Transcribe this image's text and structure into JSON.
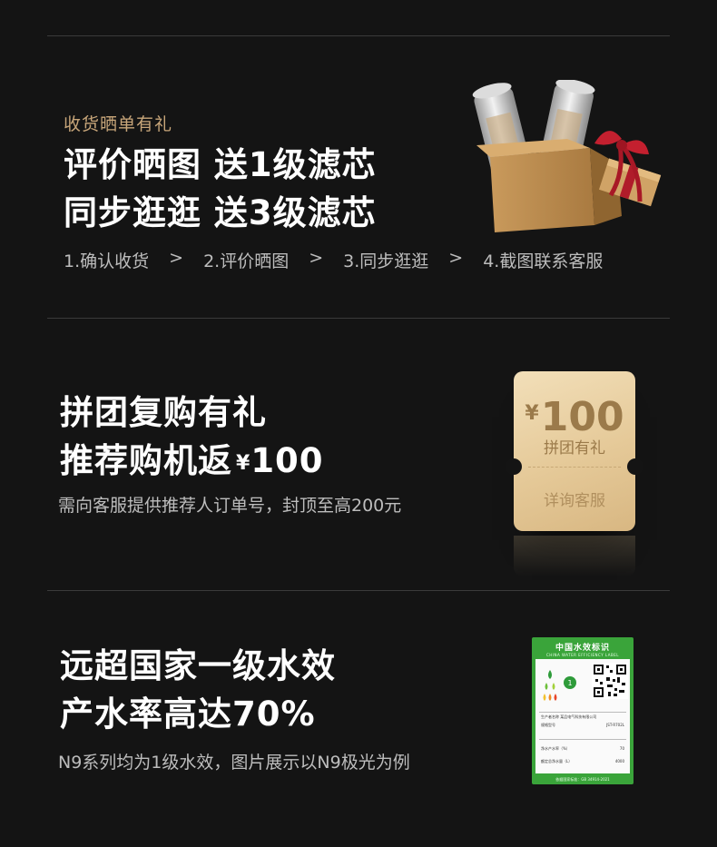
{
  "section1": {
    "kicker": "收货晒单有礼",
    "line1": "评价晒图 送1级滤芯",
    "line2": "同步逛逛 送3级滤芯",
    "steps": [
      "1.确认收货",
      "2.评价晒图",
      "3.同步逛逛",
      "4.截图联系客服"
    ],
    "step_separator": ">",
    "gift_icon": "gift-box-with-filters-icon"
  },
  "section2": {
    "line1": "拼团复购有礼",
    "line2_text": "推荐购机返",
    "line2_currency": "¥",
    "line2_amount": "100",
    "note": "需向客服提供推荐人订单号，封顶至高200元",
    "coupon": {
      "currency": "¥",
      "amount": "100",
      "label": "拼团有礼",
      "action": "详询客服"
    }
  },
  "section3": {
    "line1": "远超国家一级水效",
    "line2": "产水率高达70%",
    "note": "N9系列均为1级水效，图片展示以N9极光为例",
    "water_label": {
      "title": "中国水效标识",
      "subtitle": "CHINA WATER EFFICIENCY LABEL",
      "maker_label": "生产者名称",
      "maker": "某品电气科技有限公司",
      "model_label": "规格型号",
      "model": "JST-R702L",
      "rate_label": "净水产水率（%）",
      "rate": "70",
      "volume_label": "额定总净水量（L）",
      "volume": "4000",
      "standard": "依据国家标准：GB 34914-2021"
    }
  },
  "colors": {
    "background": "#141414",
    "accent_gold": "#c8a67a",
    "label_green": "#3aa43a"
  }
}
